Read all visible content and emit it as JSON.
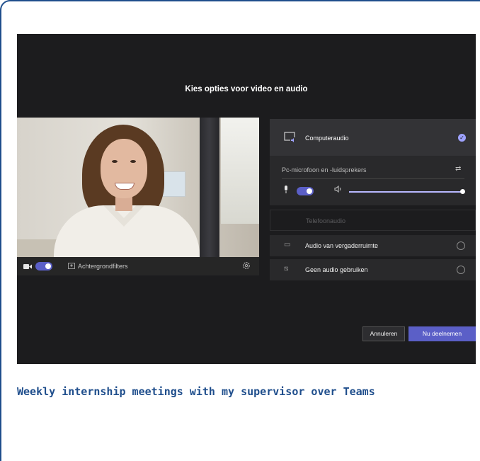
{
  "dialog": {
    "title": "Kies opties voor video en audio"
  },
  "video_bar": {
    "camera_toggle_on": true,
    "background_filters_label": "Achtergrondfilters"
  },
  "audio_options": {
    "computer_audio": {
      "label": "Computeraudio",
      "selected": true
    },
    "device_label": "Pc-microfoon en -luidsprekers",
    "mic_toggle_on": true,
    "phone_audio": {
      "label": "Telefoonaudio"
    },
    "room_audio": {
      "label": "Audio van vergaderruimte"
    },
    "no_audio": {
      "label": "Geen audio gebruiken"
    }
  },
  "buttons": {
    "cancel_label": "Annuleren",
    "join_label": "Nu deelnemen"
  },
  "caption": "Weekly internship meetings with my supervisor over Teams",
  "colors": {
    "accent": "#5b5fc7",
    "caption_text": "#1f4e8c",
    "background": "#1c1c1e"
  },
  "icons": [
    "camera-icon",
    "background-filter-icon",
    "settings-gear-icon",
    "computer-audio-icon",
    "check-icon",
    "audio-settings-icon",
    "microphone-icon",
    "speaker-icon",
    "room-icon",
    "no-audio-icon"
  ]
}
